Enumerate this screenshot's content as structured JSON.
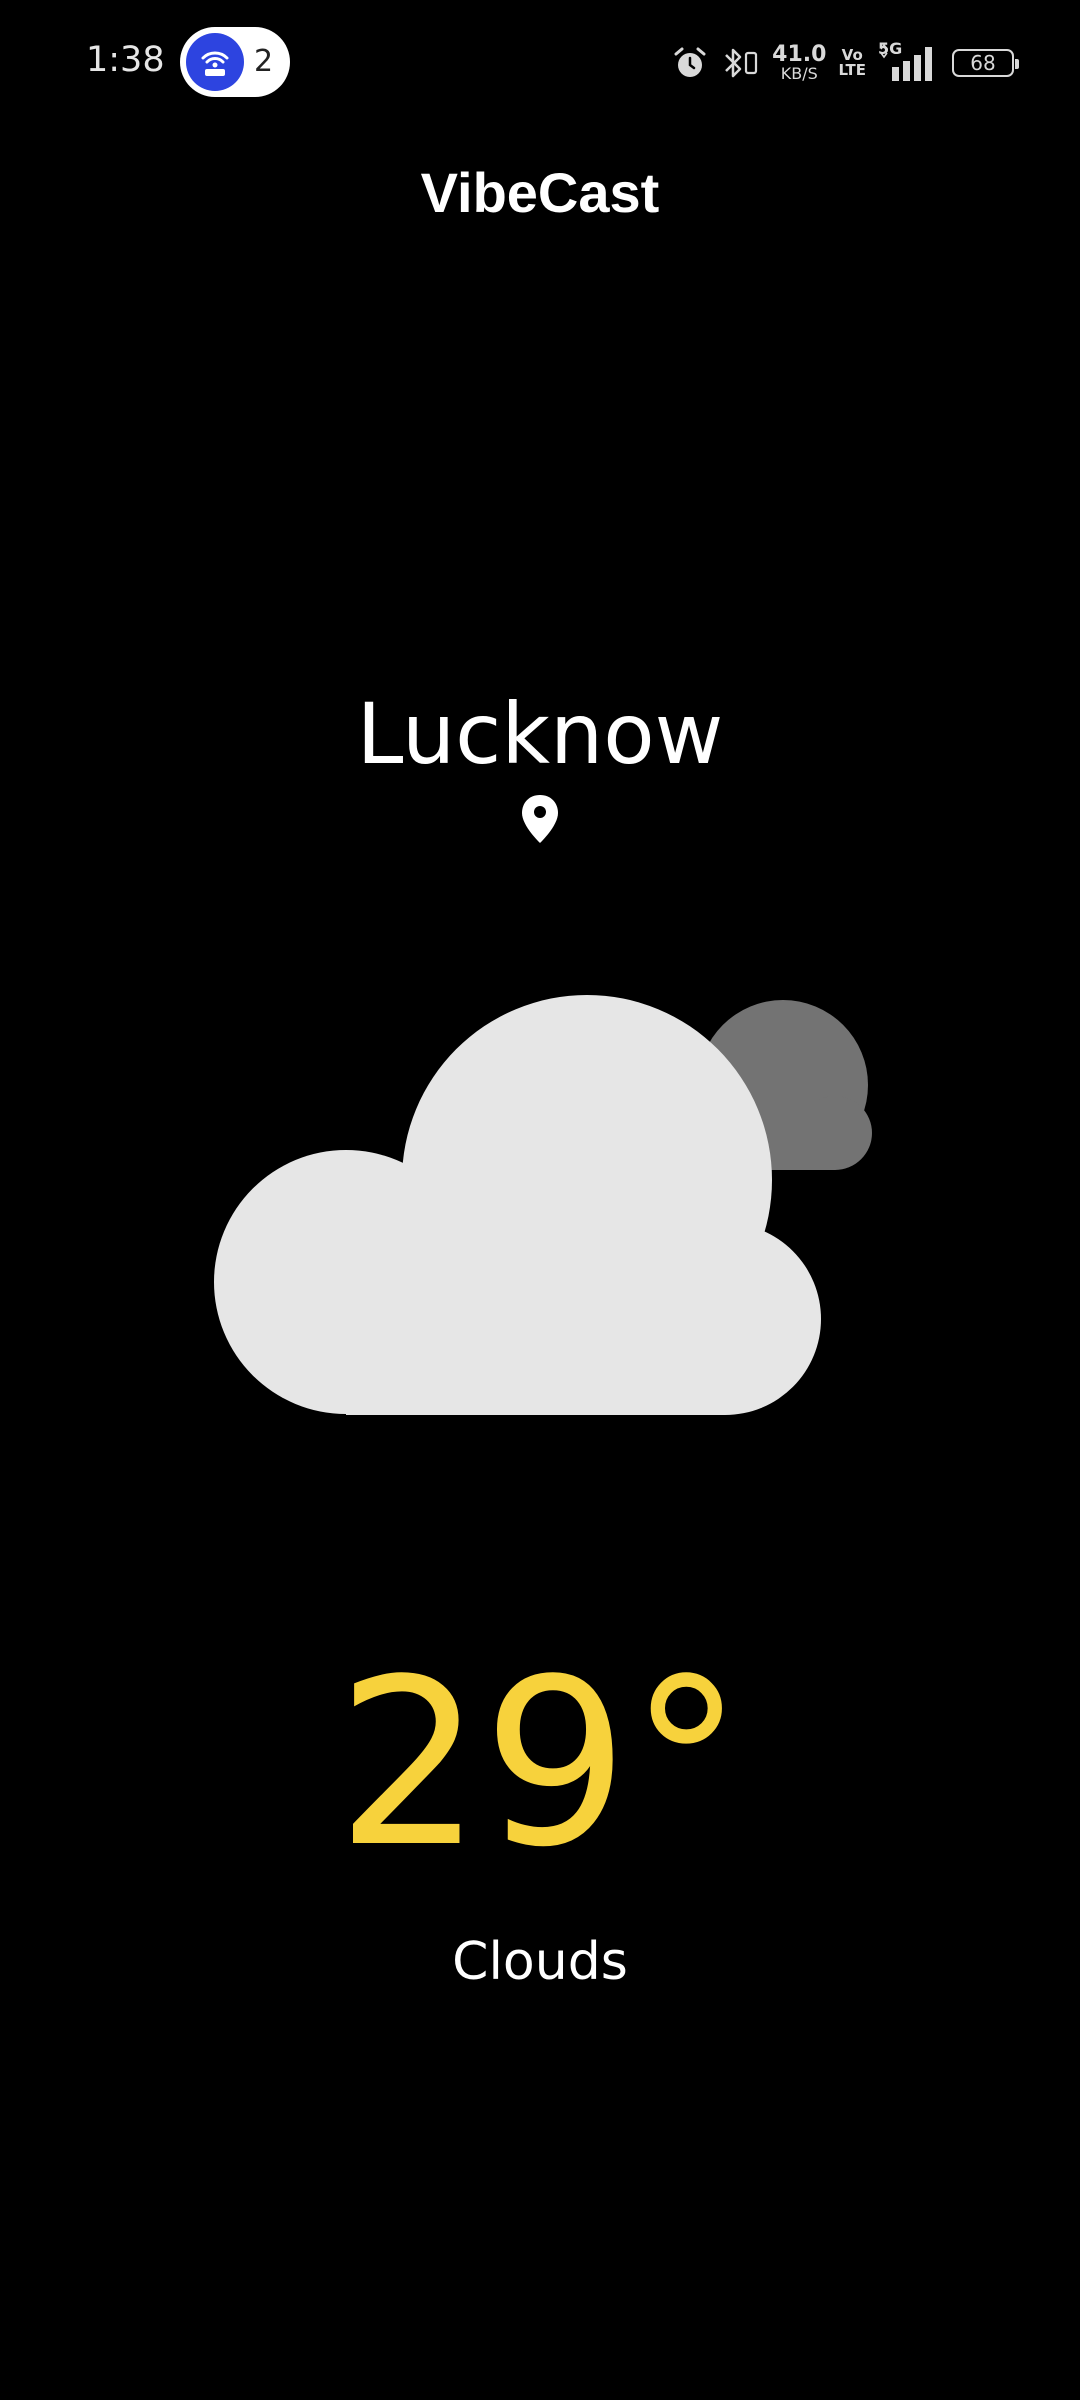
{
  "status_bar": {
    "time": "1:38",
    "hotspot_count": "2",
    "net_speed_value": "41.0",
    "net_speed_unit": "KB/S",
    "volte_top": "Vo",
    "volte_bottom": "LTE",
    "network_type": "5G",
    "battery_level": "68",
    "icons": [
      "hotspot-icon",
      "alarm-icon",
      "bluetooth-icon",
      "signal-icon",
      "battery-icon"
    ]
  },
  "app": {
    "title": "VibeCast"
  },
  "weather": {
    "city": "Lucknow",
    "temperature": "29°",
    "condition": "Clouds",
    "icon": "clouds-icon",
    "colors": {
      "temperature": "#f7d23c",
      "cloud_front": "#e6e6e6",
      "cloud_back": "#737373",
      "background": "#000000"
    }
  }
}
